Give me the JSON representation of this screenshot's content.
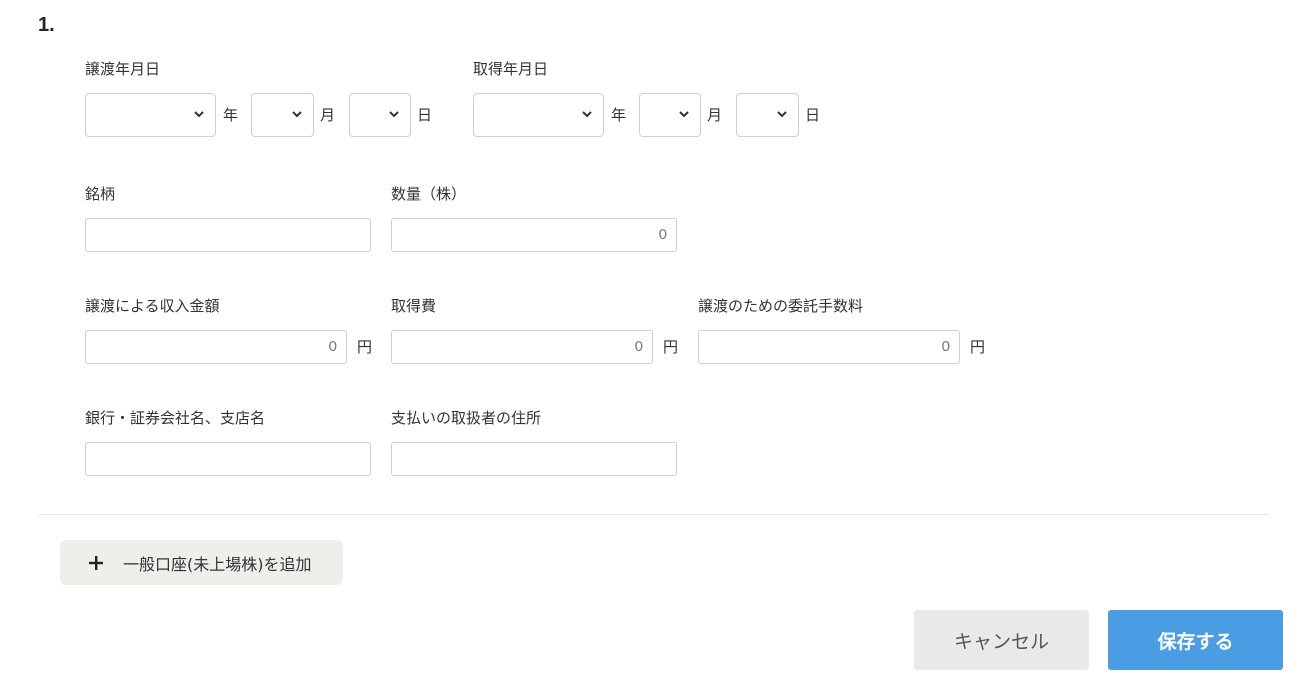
{
  "entry_number": "1.",
  "transfer_date": {
    "label": "譲渡年月日",
    "year_unit": "年",
    "month_unit": "月",
    "day_unit": "日"
  },
  "acquisition_date": {
    "label": "取得年月日",
    "year_unit": "年",
    "month_unit": "月",
    "day_unit": "日"
  },
  "fields": {
    "stock_name": {
      "label": "銘柄",
      "value": ""
    },
    "quantity": {
      "label": "数量（株）",
      "value": "0"
    },
    "transfer_proceeds": {
      "label": "譲渡による収入金額",
      "value": "0",
      "unit": "円"
    },
    "acquisition_cost": {
      "label": "取得費",
      "value": "0",
      "unit": "円"
    },
    "commission": {
      "label": "譲渡のための委託手数料",
      "value": "0",
      "unit": "円"
    },
    "broker_name": {
      "label": "銀行・証券会社名、支店名",
      "value": ""
    },
    "payer_address": {
      "label": "支払いの取扱者の住所",
      "value": ""
    }
  },
  "buttons": {
    "add_account": "一般口座(未上場株)を追加",
    "cancel": "キャンセル",
    "save": "保存する"
  },
  "icons": {
    "select_arrow": "chevron-down-icon",
    "add": "plus-icon"
  },
  "colors": {
    "primary": "#4a9de3",
    "cancel_bg": "#e9e9e9",
    "add_bg": "#eeeeea"
  }
}
